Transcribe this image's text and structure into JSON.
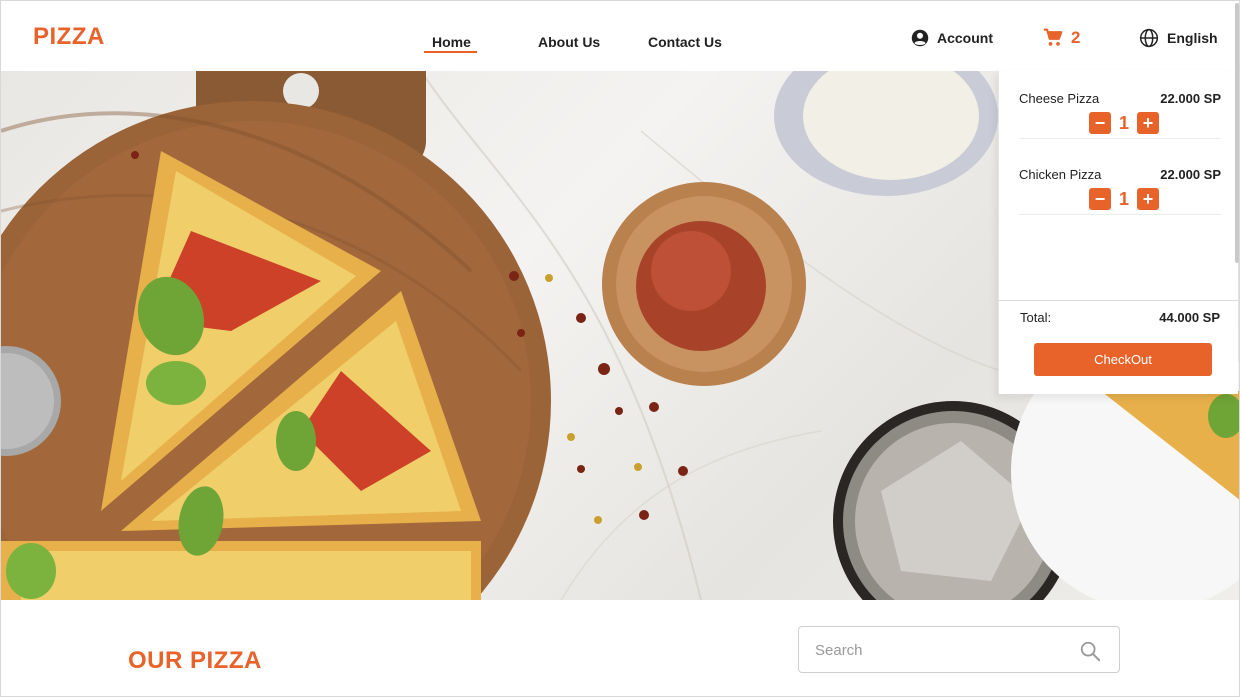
{
  "header": {
    "logo": "PIZZA",
    "nav": [
      {
        "label": "Home"
      },
      {
        "label": "About Us"
      },
      {
        "label": "Contact Us"
      }
    ],
    "account_label": "Account",
    "cart_count": "2",
    "language_label": "English"
  },
  "cart": {
    "items": [
      {
        "name": "Cheese Pizza",
        "price": "22.000 SP",
        "quantity": "1"
      },
      {
        "name": "Chicken Pizza",
        "price": "22.000 SP",
        "quantity": "1"
      }
    ],
    "total_label": "Total:",
    "total_value": "44.000 SP",
    "checkout_label": "CheckOut"
  },
  "main": {
    "section_title": "OUR PIZZA",
    "search": {
      "placeholder": "Search"
    }
  },
  "colors": {
    "accent": "#e8632a"
  },
  "icons": [
    "account-icon",
    "cart-icon",
    "globe-icon",
    "minus-icon",
    "plus-icon",
    "search-icon"
  ]
}
